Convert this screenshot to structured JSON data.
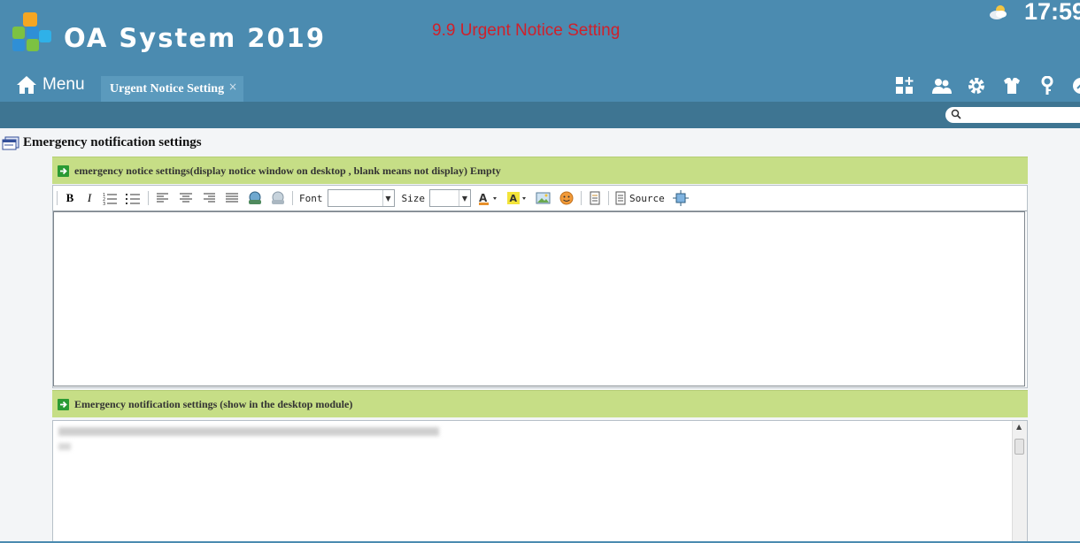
{
  "header": {
    "app_title": "OA System 2019",
    "page_caption": "9.9 Urgent Notice Setting",
    "clock": "17:59",
    "menu_label": "Menu",
    "tab_label": "Urgent Notice Setting",
    "tab_close": "×"
  },
  "toolbar_icons": [
    "add-module-icon",
    "users-icon",
    "gear-icon",
    "shirt-icon",
    "key-icon",
    "logout-icon"
  ],
  "search": {
    "placeholder": ""
  },
  "page": {
    "heading": "Emergency notification settings",
    "section1_title": "emergency notice settings(display notice window on desktop , blank means not display)  Empty",
    "section2_title": "Emergency notification settings (show in the desktop module)"
  },
  "editor": {
    "font_label": "Font",
    "size_label": "Size",
    "source_label": "Source",
    "font_value": "",
    "size_value": ""
  },
  "colors": {
    "header_bg": "#4b8bb0",
    "subbar_bg": "#3e7592",
    "section_bar": "#c6de86",
    "caption_red": "#d0202a"
  }
}
